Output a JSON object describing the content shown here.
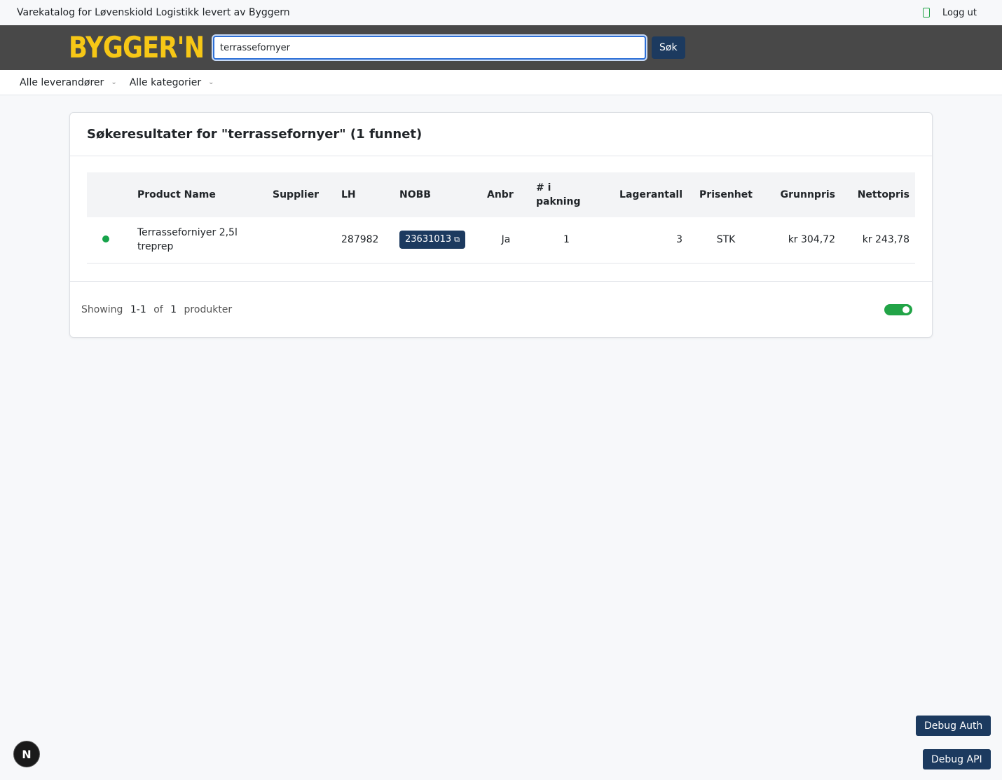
{
  "topbar": {
    "title": "Varekatalog for Løvenskiold Logistikk levert av Byggern",
    "logout_label": "Logg ut"
  },
  "header": {
    "logo_text": "BYGGER'N",
    "search_value": "terrassefornyer",
    "search_button": "Søk"
  },
  "filters": {
    "supplier": "Alle leverandører",
    "category": "Alle kategorier"
  },
  "results": {
    "heading": "Søkeresultater for \"terrassefornyer\" (1 funnet)",
    "columns": [
      "",
      "Product Name",
      "Supplier",
      "LH",
      "NOBB",
      "Anbr",
      "# i pakning",
      "Lagerantall",
      "Prisenhet",
      "Grunnpris",
      "Nettopris"
    ],
    "rows": [
      {
        "status": "in-stock",
        "product_name": "Terrasseforniyer 2,5l treprep",
        "supplier": "",
        "lh": "287982",
        "nobb": "23631013",
        "anbr": "Ja",
        "pakning": "1",
        "lagerantall": "3",
        "prisenhet": "STK",
        "grunnpris": "kr 304,72",
        "nettopris": "kr 243,78"
      }
    ]
  },
  "pagination": {
    "showing": "Showing",
    "range": "1-1",
    "of": "of",
    "total": "1",
    "unit": "produkter"
  },
  "debug": {
    "auth_label": "Debug Auth",
    "api_label": "Debug API"
  },
  "next_badge": "N",
  "colors": {
    "brand_yellow": "#f6c716",
    "navy": "#1c3a5f",
    "status_green": "#16a34a"
  }
}
